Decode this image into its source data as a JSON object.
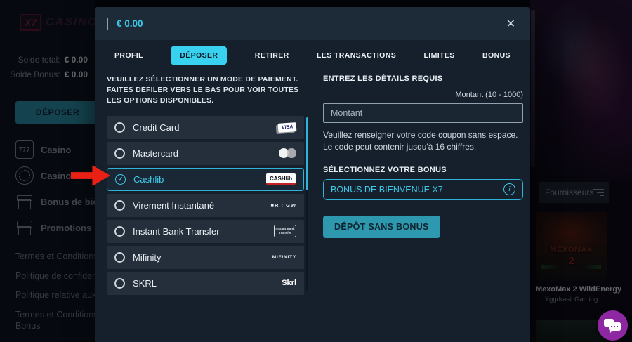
{
  "colors": {
    "accent": "#38d1ef",
    "accent-text": "#3fc9e9",
    "accent-border": "#2fb3d6",
    "button-teal": "#2e98ae",
    "arrow-red": "#ea2015",
    "chat-purple": "#8e27a2"
  },
  "page": {
    "sidebar": {
      "logo_box": "X7",
      "logo_rest": "CASINO",
      "balances": [
        {
          "label": "Solde total:",
          "value": "€ 0.00"
        },
        {
          "label": "Solde Bonus:",
          "value": "€ 0.00"
        }
      ],
      "deposit_button": "DÉPOSER",
      "menu": [
        {
          "icon": "slots-icon",
          "icon_text": "777",
          "label": "Casino"
        },
        {
          "icon": "roulette-icon",
          "icon_text": "",
          "label": "Casino en direct"
        },
        {
          "icon": "gift-icon",
          "icon_text": "",
          "label": "Bonus de bienvenue"
        },
        {
          "icon": "shop-icon",
          "icon_text": "",
          "label": "Promotions"
        }
      ],
      "links": [
        "Termes et Conditions",
        "Politique de confidentialité",
        "Politique relative aux cookies",
        "Termes et Conditions des Bonus"
      ]
    },
    "right_panel": {
      "providers_label": "Fournisseurs",
      "game": {
        "art_text": "MEXOMAX",
        "art_number": "2",
        "title": "MexoMax 2 WildEnergy",
        "provider": "Yggdrasil Gaming"
      }
    }
  },
  "modal": {
    "balance": "€ 0.00",
    "tabs": [
      {
        "label": "PROFIL",
        "active": false
      },
      {
        "label": "DÉPOSER",
        "active": true
      },
      {
        "label": "RETIRER",
        "active": false
      },
      {
        "label": "LES TRANSACTIONS",
        "active": false
      },
      {
        "label": "LIMITES",
        "active": false
      },
      {
        "label": "BONUS",
        "active": false
      }
    ],
    "payments": {
      "instruction": "VEUILLEZ SÉLECTIONNER UN MODE DE PAIEMENT. FAITES DÉFILER VERS LE BAS POUR VOIR TOUTES LES OPTIONS DISPONIBLES.",
      "methods": [
        {
          "label": "Credit Card",
          "selected": false,
          "logo": {
            "type": "visa",
            "text": "VISA"
          }
        },
        {
          "label": "Mastercard",
          "selected": false,
          "logo": {
            "type": "mastercard",
            "text": ""
          }
        },
        {
          "label": "Cashlib",
          "selected": true,
          "logo": {
            "type": "cashlib",
            "text": "CASHlib"
          }
        },
        {
          "label": "Virement Instantané",
          "selected": false,
          "logo": {
            "type": "banks",
            "text": "■R : GW"
          }
        },
        {
          "label": "Instant Bank Transfer",
          "selected": false,
          "logo": {
            "type": "ibt",
            "text": "Instant Bank Transfer"
          }
        },
        {
          "label": "Mifinity",
          "selected": false,
          "logo": {
            "type": "mifinity",
            "text": "MiFINITY"
          }
        },
        {
          "label": "SKRL",
          "selected": false,
          "logo": {
            "type": "skrl",
            "text": "Skrl"
          }
        }
      ]
    },
    "details": {
      "heading": "ENTREZ LES DÉTAILS REQUIS",
      "amount_hint": "Montant (10 - 1000)",
      "amount_placeholder": "Montant",
      "coupon_note": "Veuillez renseigner votre code coupon sans espace. Le code peut contenir jusqu'à 16 chiffres.",
      "bonus_heading": "SÉLECTIONNEZ VOTRE BONUS",
      "bonus_value": "BONUS DE BIENVENUE X7",
      "deposit_no_bonus": "DÉPÔT SANS BONUS"
    }
  }
}
